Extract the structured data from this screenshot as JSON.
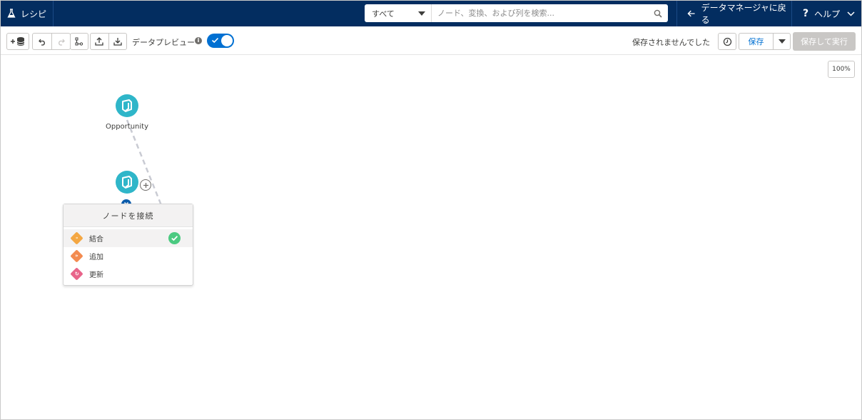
{
  "header": {
    "app_title": "レシピ",
    "search_scope": "すべて",
    "search_placeholder": "ノード、変換、および列を検索...",
    "back_label": "データマネージャに戻る",
    "help_label": "ヘルプ"
  },
  "toolbar": {
    "data_preview_label": "データプレビュー",
    "data_preview_on": true,
    "status_text": "保存されませんでした",
    "save_label": "保存",
    "save_run_label": "保存して実行"
  },
  "canvas": {
    "zoom_label": "100%",
    "nodes": [
      {
        "label": "Opportunity"
      },
      {
        "label": ""
      }
    ],
    "popover": {
      "title": "ノードを接続",
      "items": [
        {
          "label": "結合",
          "icon": "join-icon",
          "color": "#f4a742",
          "selected": true
        },
        {
          "label": "追加",
          "icon": "append-icon",
          "color": "#f38b50",
          "selected": false
        },
        {
          "label": "更新",
          "icon": "update-icon",
          "color": "#e8648a",
          "selected": false
        }
      ]
    }
  },
  "colors": {
    "header_bg": "#032d60",
    "node": "#2fb6c9",
    "accent": "#0070d2",
    "success": "#4bca81"
  }
}
